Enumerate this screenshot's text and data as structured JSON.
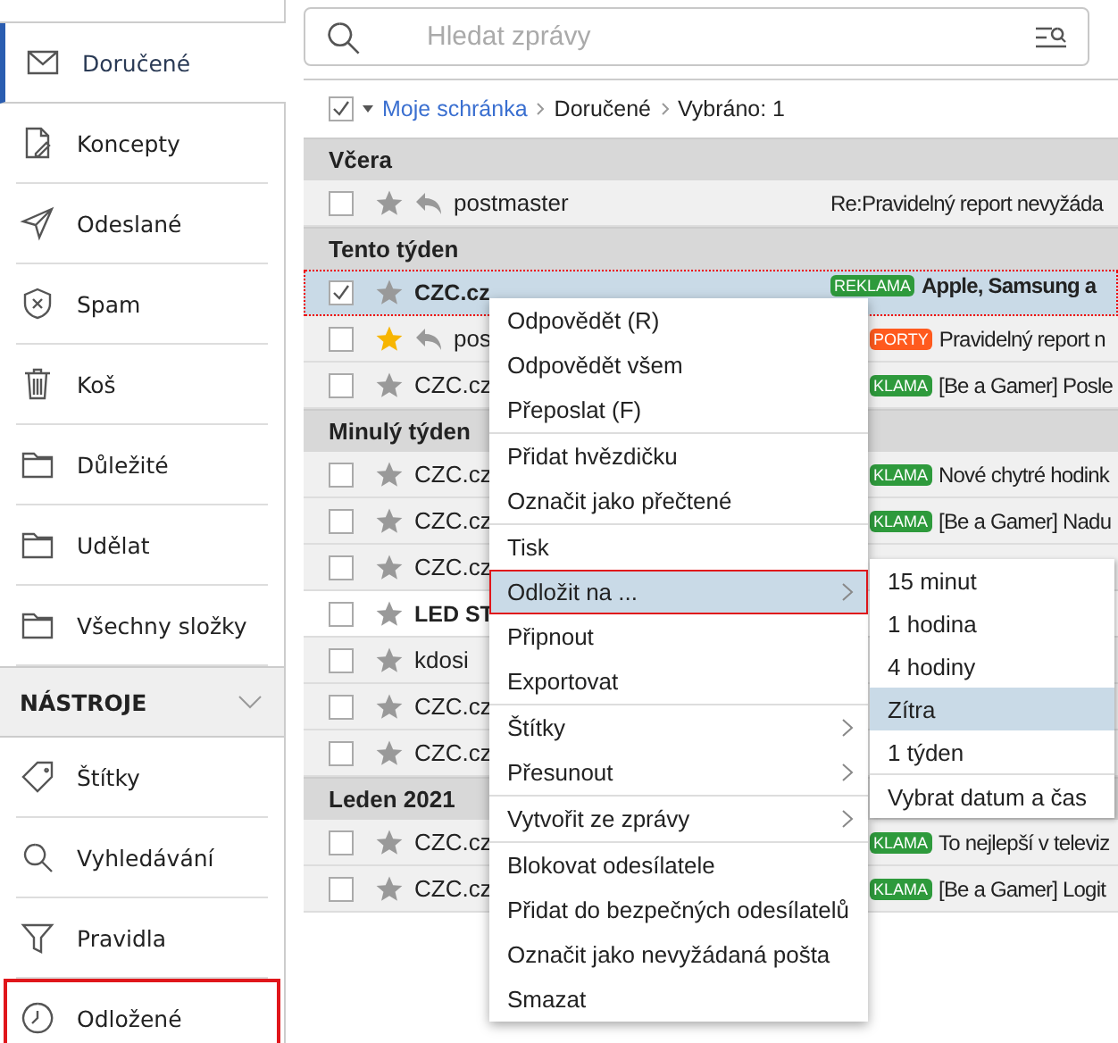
{
  "sidebar": {
    "items": [
      {
        "label": "Doručené",
        "selected": true,
        "outlined": false
      },
      {
        "label": "Koncepty",
        "selected": false,
        "outlined": false
      },
      {
        "label": "Odeslané",
        "selected": false,
        "outlined": false
      },
      {
        "label": "Spam",
        "selected": false,
        "outlined": false
      },
      {
        "label": "Koš",
        "selected": false,
        "outlined": false
      },
      {
        "label": "Důležité",
        "selected": false,
        "outlined": false
      },
      {
        "label": "Udělat",
        "selected": false,
        "outlined": false
      },
      {
        "label": "Všechny složky",
        "selected": false,
        "outlined": false
      }
    ],
    "tools": {
      "title": "NÁSTROJE",
      "expanded": true,
      "items": [
        {
          "label": "Štítky",
          "selected": false,
          "outlined": false
        },
        {
          "label": "Vyhledávání",
          "selected": false,
          "outlined": false
        },
        {
          "label": "Pravidla",
          "selected": false,
          "outlined": false
        },
        {
          "label": "Odložené",
          "selected": false,
          "outlined": true
        }
      ]
    }
  },
  "search": {
    "placeholder": "Hledat zprávy"
  },
  "breadcrumb": {
    "select_all_checked": true,
    "link": "Moje schránka",
    "items": [
      "Doručené",
      "Vybráno: 1"
    ]
  },
  "groups": [
    {
      "title": "Včera",
      "rows": [
        {
          "sender": "postmaster",
          "subject": "Re:Pravidelný report nevyžáda",
          "checked": false,
          "starred": false,
          "replied": true,
          "unread": false,
          "selected": false
        }
      ]
    },
    {
      "title": "Tento týden",
      "rows": [
        {
          "sender": "CZC.cz",
          "tag": {
            "label": "REKLAMA",
            "color": "#2e9a3c"
          },
          "subject": "Apple, Samsung a",
          "checked": true,
          "starred": false,
          "replied": false,
          "unread": true,
          "selected": true
        },
        {
          "sender": "pos",
          "tag": {
            "label": "PORTY",
            "color": "#ff5a1e"
          },
          "subject": "Pravidelný report n",
          "checked": false,
          "starred": true,
          "replied": true,
          "unread": false,
          "selected": false
        },
        {
          "sender": "CZC.cz",
          "tag": {
            "label": "KLAMA",
            "color": "#2e9a3c"
          },
          "subject": "[Be a Gamer] Posle",
          "checked": false,
          "starred": false,
          "replied": false,
          "unread": false,
          "selected": false
        }
      ]
    },
    {
      "title": "Minulý týden",
      "rows": [
        {
          "sender": "CZC.cz",
          "tag": {
            "label": "KLAMA",
            "color": "#2e9a3c"
          },
          "subject": "Nové chytré hodink",
          "checked": false,
          "starred": false,
          "replied": false,
          "unread": false,
          "selected": false
        },
        {
          "sender": "CZC.cz",
          "tag": {
            "label": "KLAMA",
            "color": "#2e9a3c"
          },
          "subject": "[Be a Gamer] Nadu",
          "checked": false,
          "starred": false,
          "replied": false,
          "unread": false,
          "selected": false
        },
        {
          "sender": "CZC.cz",
          "checked": false,
          "starred": false,
          "replied": false,
          "unread": false,
          "selected": false
        },
        {
          "sender": "LED ST",
          "checked": false,
          "starred": false,
          "replied": false,
          "unread": true,
          "selected": false
        },
        {
          "sender": "kdosi",
          "checked": false,
          "starred": false,
          "replied": false,
          "unread": false,
          "selected": false
        },
        {
          "sender": "CZC.cz",
          "checked": false,
          "starred": false,
          "replied": false,
          "unread": false,
          "selected": false
        },
        {
          "sender": "CZC.cz",
          "checked": false,
          "starred": false,
          "replied": false,
          "unread": false,
          "selected": false
        }
      ]
    },
    {
      "title": "Leden 2021",
      "rows": [
        {
          "sender": "CZC.cz",
          "tag": {
            "label": "KLAMA",
            "color": "#2e9a3c"
          },
          "subject": "To nejlepší v televiz",
          "checked": false,
          "starred": false,
          "replied": false,
          "unread": false,
          "selected": false
        },
        {
          "sender": "CZC.cz",
          "tag": {
            "label": "KLAMA",
            "color": "#2e9a3c"
          },
          "subject": "[Be a Gamer] Logit",
          "checked": false,
          "starred": false,
          "replied": false,
          "unread": false,
          "selected": false
        }
      ]
    }
  ],
  "context_menu": {
    "sections": [
      [
        {
          "label": "Odpovědět (R)",
          "submenu": false,
          "selected": false
        },
        {
          "label": "Odpovědět všem",
          "submenu": false,
          "selected": false
        },
        {
          "label": "Přeposlat (F)",
          "submenu": false,
          "selected": false
        }
      ],
      [
        {
          "label": "Přidat hvězdičku",
          "submenu": false,
          "selected": false
        },
        {
          "label": "Označit jako přečtené",
          "submenu": false,
          "selected": false
        }
      ],
      [
        {
          "label": "Tisk",
          "submenu": false,
          "selected": false
        },
        {
          "label": "Odložit na ...",
          "submenu": true,
          "selected": true
        },
        {
          "label": "Připnout",
          "submenu": false,
          "selected": false
        },
        {
          "label": "Exportovat",
          "submenu": false,
          "selected": false
        }
      ],
      [
        {
          "label": "Štítky",
          "submenu": true,
          "selected": false
        },
        {
          "label": "Přesunout",
          "submenu": true,
          "selected": false
        }
      ],
      [
        {
          "label": "Vytvořit ze zprávy",
          "submenu": true,
          "selected": false
        }
      ],
      [
        {
          "label": "Blokovat odesílatele",
          "submenu": false,
          "selected": false
        },
        {
          "label": "Přidat do bezpečných odesílatelů",
          "submenu": false,
          "selected": false
        },
        {
          "label": "Označit jako nevyžádaná pošta",
          "submenu": false,
          "selected": false
        },
        {
          "label": "Smazat",
          "submenu": false,
          "selected": false
        }
      ]
    ],
    "submenu": {
      "sections": [
        [
          {
            "label": "15 minut",
            "selected": false
          },
          {
            "label": "1 hodina",
            "selected": false
          },
          {
            "label": "4 hodiny",
            "selected": false
          },
          {
            "label": "Zítra",
            "selected": true
          },
          {
            "label": "1 týden",
            "selected": false
          }
        ],
        [
          {
            "label": "Vybrat datum a čas",
            "selected": false
          }
        ]
      ]
    }
  }
}
